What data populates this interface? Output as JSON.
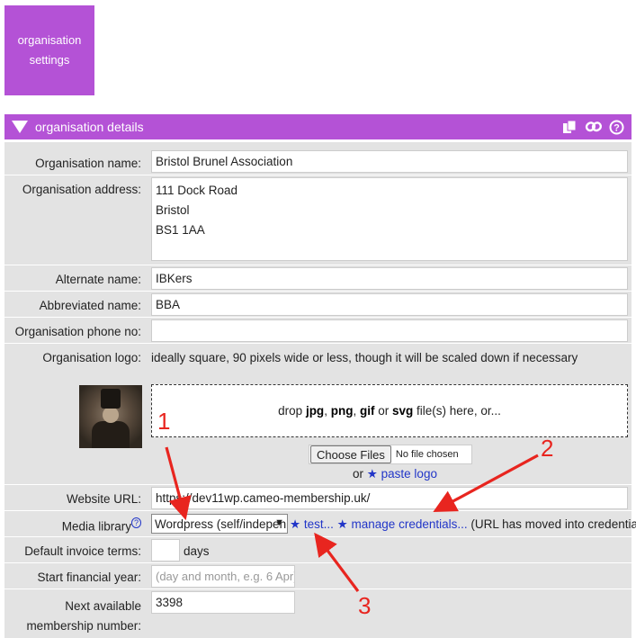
{
  "settings_button": {
    "line1": "organisation",
    "line2": "settings"
  },
  "header": {
    "title": "organisation details"
  },
  "fields": {
    "name": {
      "label": "Organisation name:",
      "value": "Bristol Brunel Association"
    },
    "address": {
      "label": "Organisation address:",
      "lines": [
        "111 Dock Road",
        "Bristol",
        "BS1 1AA"
      ]
    },
    "alternate": {
      "label": "Alternate name:",
      "value": "IBKers"
    },
    "abbreviated": {
      "label": "Abbreviated name:",
      "value": "BBA"
    },
    "phone": {
      "label": "Organisation phone no:",
      "value": ""
    },
    "logo": {
      "label": "Organisation logo:",
      "hint": "ideally square, 90 pixels wide or less, though it will be scaled down if necessary"
    },
    "website": {
      "label": "Website URL:",
      "value": "https://dev11wp.cameo-membership.uk/"
    },
    "media": {
      "label": "Media library",
      "sup": "?",
      "selected": "Wordpress (self/indepen",
      "test": "test...",
      "manage": "manage credentials...",
      "note": "(URL has moved into credentials)"
    },
    "invoice": {
      "label": "Default invoice terms:",
      "value": "",
      "suffix": "days"
    },
    "financial": {
      "label": "Start financial year:",
      "placeholder": "(day and month, e.g. 6 Apr)"
    },
    "membership": {
      "label_line1": "Next available",
      "label_line2": "membership number:",
      "value": "3398"
    }
  },
  "dropzone": {
    "prefix": "drop",
    "jpg": "jpg",
    "png": "png",
    "gif": "gif",
    "or1": "or",
    "svg": "svg",
    "suffix": "file(s) here, or..."
  },
  "file_input": {
    "button": "Choose Files",
    "status": "No file chosen"
  },
  "paste": {
    "or": "or",
    "label": "paste logo"
  },
  "annotations": {
    "n1": "1",
    "n2": "2",
    "n3": "3"
  },
  "colors": {
    "accent": "#b452d6",
    "panel": "#e3e3e3",
    "annotation": "#e8251f",
    "link": "#2236c8"
  }
}
